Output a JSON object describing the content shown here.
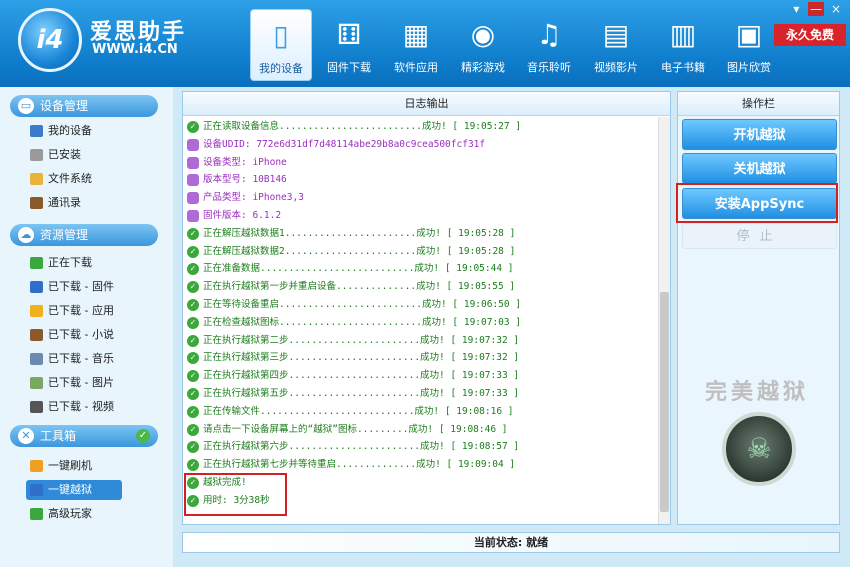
{
  "header": {
    "logo_text": "i4",
    "app_name": "爱思助手",
    "url": "WWW.i4.CN",
    "free_badge": "永久免费",
    "tabs": [
      {
        "label": "我的设备",
        "icon": "device-icon",
        "glyph": "▯"
      },
      {
        "label": "固件下载",
        "icon": "dice-icon",
        "glyph": "⚅"
      },
      {
        "label": "软件应用",
        "icon": "grid-icon",
        "glyph": "▦"
      },
      {
        "label": "精彩游戏",
        "icon": "gamepad-icon",
        "glyph": "◉"
      },
      {
        "label": "音乐聆听",
        "icon": "music-icon",
        "glyph": "♫"
      },
      {
        "label": "视频影片",
        "icon": "film-icon",
        "glyph": "▤"
      },
      {
        "label": "电子书籍",
        "icon": "book-icon",
        "glyph": "▥"
      },
      {
        "label": "图片欣赏",
        "icon": "picture-icon",
        "glyph": "▣"
      }
    ],
    "window_controls": {
      "menu": "▾",
      "minimize": "—",
      "close": "×"
    }
  },
  "sidebar": {
    "device_section": {
      "title": "设备管理",
      "items": [
        {
          "label": "我的设备",
          "icon": "phone-icon",
          "color": "#3a7cc9"
        },
        {
          "label": "已安装",
          "icon": "apps-icon",
          "color": "#9a9a9a"
        },
        {
          "label": "文件系统",
          "icon": "folder-icon",
          "color": "#e8b43a"
        },
        {
          "label": "通讯录",
          "icon": "contacts-icon",
          "color": "#8a5a2c"
        }
      ]
    },
    "resource_section": {
      "title": "资源管理",
      "items": [
        {
          "label": "正在下载",
          "icon": "download-icon",
          "color": "#3aa83a"
        },
        {
          "label": "已下载 - 固件",
          "icon": "ios-icon",
          "color": "#2f6fc9"
        },
        {
          "label": "已下载 - 应用",
          "icon": "star-icon",
          "color": "#f0b020"
        },
        {
          "label": "已下载 - 小说",
          "icon": "book-icon",
          "color": "#8a5a2c"
        },
        {
          "label": "已下载 - 音乐",
          "icon": "music-icon",
          "color": "#6a8ab0"
        },
        {
          "label": "已下载 - 图片",
          "icon": "picture-icon",
          "color": "#7aa860"
        },
        {
          "label": "已下载 - 视频",
          "icon": "video-icon",
          "color": "#555555"
        }
      ]
    },
    "tools_section": {
      "title": "工具箱",
      "items": [
        {
          "label": "一键刷机",
          "icon": "flash-icon",
          "color": "#f0a020"
        },
        {
          "label": "一键越狱",
          "icon": "jailbreak-icon",
          "color": "#2f6fc9"
        },
        {
          "label": "高级玩家",
          "icon": "user-icon",
          "color": "#3aa83a"
        }
      ]
    }
  },
  "log": {
    "title": "日志输出",
    "lines": [
      {
        "type": "ok",
        "text": "正在读取设备信息.........................成功! [ 19:05:27 ]"
      },
      {
        "type": "info",
        "text": "设备UDID: 772e6d31df7d48114abe29b8a0c9cea500fcf31f"
      },
      {
        "type": "info",
        "text": "设备类型: iPhone"
      },
      {
        "type": "info",
        "text": "版本型号: 10B146"
      },
      {
        "type": "info",
        "text": "产品类型: iPhone3,3"
      },
      {
        "type": "info",
        "text": "固件版本: 6.1.2"
      },
      {
        "type": "ok",
        "text": "正在解压越狱数据1.......................成功! [ 19:05:28 ]"
      },
      {
        "type": "ok",
        "text": "正在解压越狱数据2.......................成功! [ 19:05:28 ]"
      },
      {
        "type": "ok",
        "text": "正在准备数据...........................成功! [ 19:05:44 ]"
      },
      {
        "type": "ok",
        "text": "正在执行越狱第一步并重启设备..............成功! [ 19:05:55 ]"
      },
      {
        "type": "ok",
        "text": "正在等待设备重启.........................成功! [ 19:06:50 ]"
      },
      {
        "type": "ok",
        "text": "正在检查越狱图标.........................成功! [ 19:07:03 ]"
      },
      {
        "type": "ok",
        "text": "正在执行越狱第二步.......................成功! [ 19:07:32 ]"
      },
      {
        "type": "ok",
        "text": "正在执行越狱第三步.......................成功! [ 19:07:32 ]"
      },
      {
        "type": "ok",
        "text": "正在执行越狱第四步.......................成功! [ 19:07:33 ]"
      },
      {
        "type": "ok",
        "text": "正在执行越狱第五步.......................成功! [ 19:07:33 ]"
      },
      {
        "type": "ok",
        "text": "正在传输文件...........................成功! [ 19:08:16 ]"
      },
      {
        "type": "ok",
        "text": "请点击一下设备屏幕上的“越狱”图标.........成功! [ 19:08:46 ]"
      },
      {
        "type": "ok",
        "text": "正在执行越狱第六步.......................成功! [ 19:08:57 ]"
      },
      {
        "type": "ok",
        "text": "正在执行越狱第七步并等待重启..............成功! [ 19:09:04 ]"
      },
      {
        "type": "ok",
        "text": "越狱完成!"
      },
      {
        "type": "ok",
        "text": "用时: 3分38秒"
      }
    ]
  },
  "operations": {
    "title": "操作栏",
    "buttons": [
      "开机越狱",
      "关机越狱",
      "安装AppSync"
    ],
    "stop_label": "停止",
    "watermark": "完美越狱"
  },
  "status": {
    "text": "当前状态: 就绪"
  }
}
